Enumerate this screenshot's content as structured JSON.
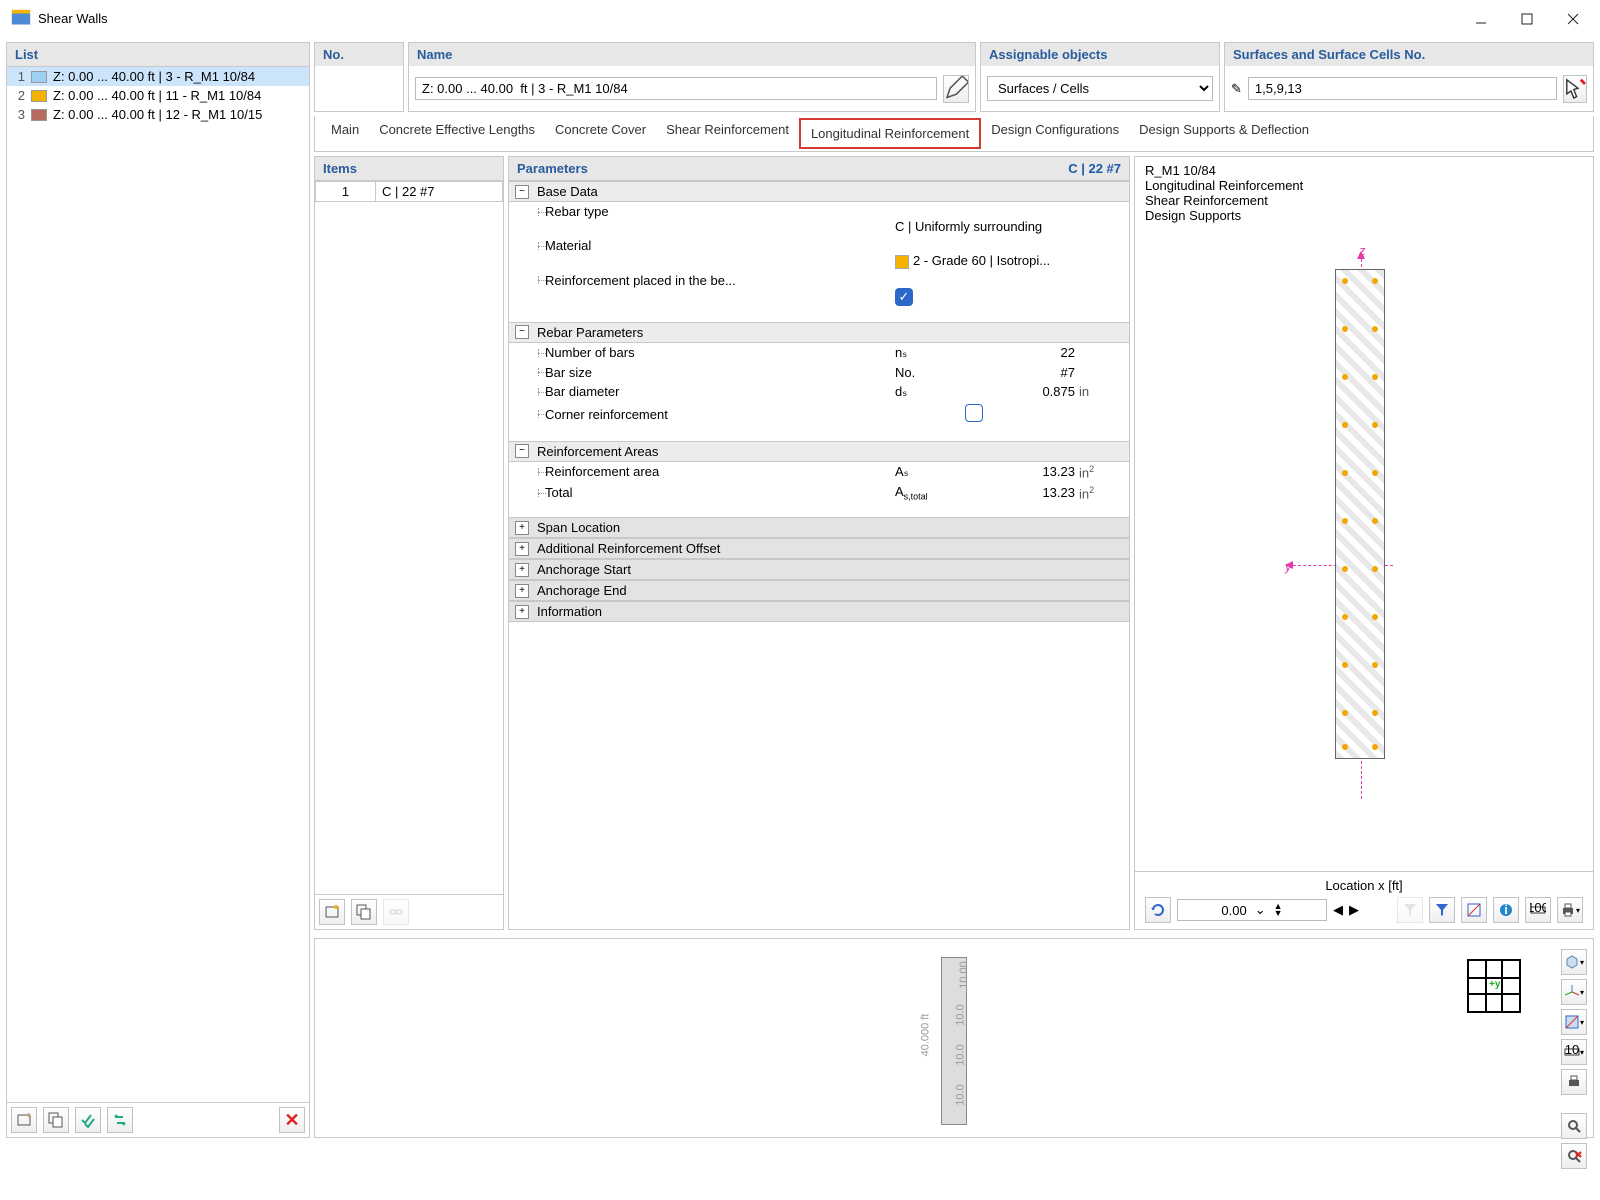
{
  "window": {
    "title": "Shear Walls"
  },
  "list": {
    "header": "List",
    "items": [
      {
        "idx": "1",
        "color": "#9fd0f3",
        "label": "Z: 0.00 ... 40.00 ft | 3 - R_M1 10/84",
        "selected": true
      },
      {
        "idx": "2",
        "color": "#f3b300",
        "label": "Z: 0.00 ... 40.00 ft | 11 - R_M1 10/84",
        "selected": false
      },
      {
        "idx": "3",
        "color": "#b86a5f",
        "label": "Z: 0.00 ... 40.00 ft | 12 - R_M1 10/15",
        "selected": false
      }
    ]
  },
  "header": {
    "no_label": "No.",
    "name_label": "Name",
    "name_value": "Z: 0.00 ... 40.00  ft | 3 - R_M1 10/84",
    "assign_label": "Assignable objects",
    "assign_value": "Surfaces / Cells",
    "surf_label": "Surfaces and Surface Cells No.",
    "surf_value": "1,5,9,13"
  },
  "tabs": [
    {
      "label": "Main",
      "active": false
    },
    {
      "label": "Concrete Effective Lengths",
      "active": false
    },
    {
      "label": "Concrete Cover",
      "active": false
    },
    {
      "label": "Shear Reinforcement",
      "active": false
    },
    {
      "label": "Longitudinal Reinforcement",
      "active": true
    },
    {
      "label": "Design Configurations",
      "active": false
    },
    {
      "label": "Design Supports & Deflection",
      "active": false
    }
  ],
  "items": {
    "header": "Items",
    "rows": [
      {
        "n": "1",
        "v": "C | 22 #7"
      }
    ]
  },
  "params": {
    "header": "Parameters",
    "code": "C | 22 #7",
    "base_data": {
      "title": "Base Data",
      "rebar_type_lab": "Rebar type",
      "rebar_type_val": "C | Uniformly surrounding",
      "material_lab": "Material",
      "material_val": "2 - Grade 60 | Isotropi...",
      "be_lab": "Reinforcement placed in the be..."
    },
    "rebar_params": {
      "title": "Rebar Parameters",
      "nbars_lab": "Number of bars",
      "nbars_sym": "nₛ",
      "nbars_val": "22",
      "size_lab": "Bar size",
      "size_sym": "No.",
      "size_val": "#7",
      "dia_lab": "Bar diameter",
      "dia_sym": "dₛ",
      "dia_val": "0.875",
      "dia_unit": "in",
      "corner_lab": "Corner reinforcement"
    },
    "areas": {
      "title": "Reinforcement Areas",
      "a_lab": "Reinforcement area",
      "a_sym": "Aₛ",
      "a_val": "13.23",
      "a_unit": "in²",
      "t_lab": "Total",
      "t_sym": "Aₛ,total",
      "t_val": "13.23",
      "t_unit": "in²"
    },
    "collapsed": [
      "Span Location",
      "Additional Reinforcement Offset",
      "Anchorage Start",
      "Anchorage End",
      "Information"
    ]
  },
  "preview": {
    "labels": [
      "R_M1 10/84",
      "Longitudinal Reinforcement",
      "Shear Reinforcement",
      "Design Supports"
    ],
    "axis_z": "z",
    "axis_y": "y",
    "loc_label": "Location x [ft]",
    "loc_value": "0.00"
  },
  "bottom": {
    "dim_full": "40.000 ft",
    "dim_seg": "10.0",
    "dim_seg2": "10.0",
    "dim_seg3": "10.0",
    "dim_seg4": "10.00"
  }
}
